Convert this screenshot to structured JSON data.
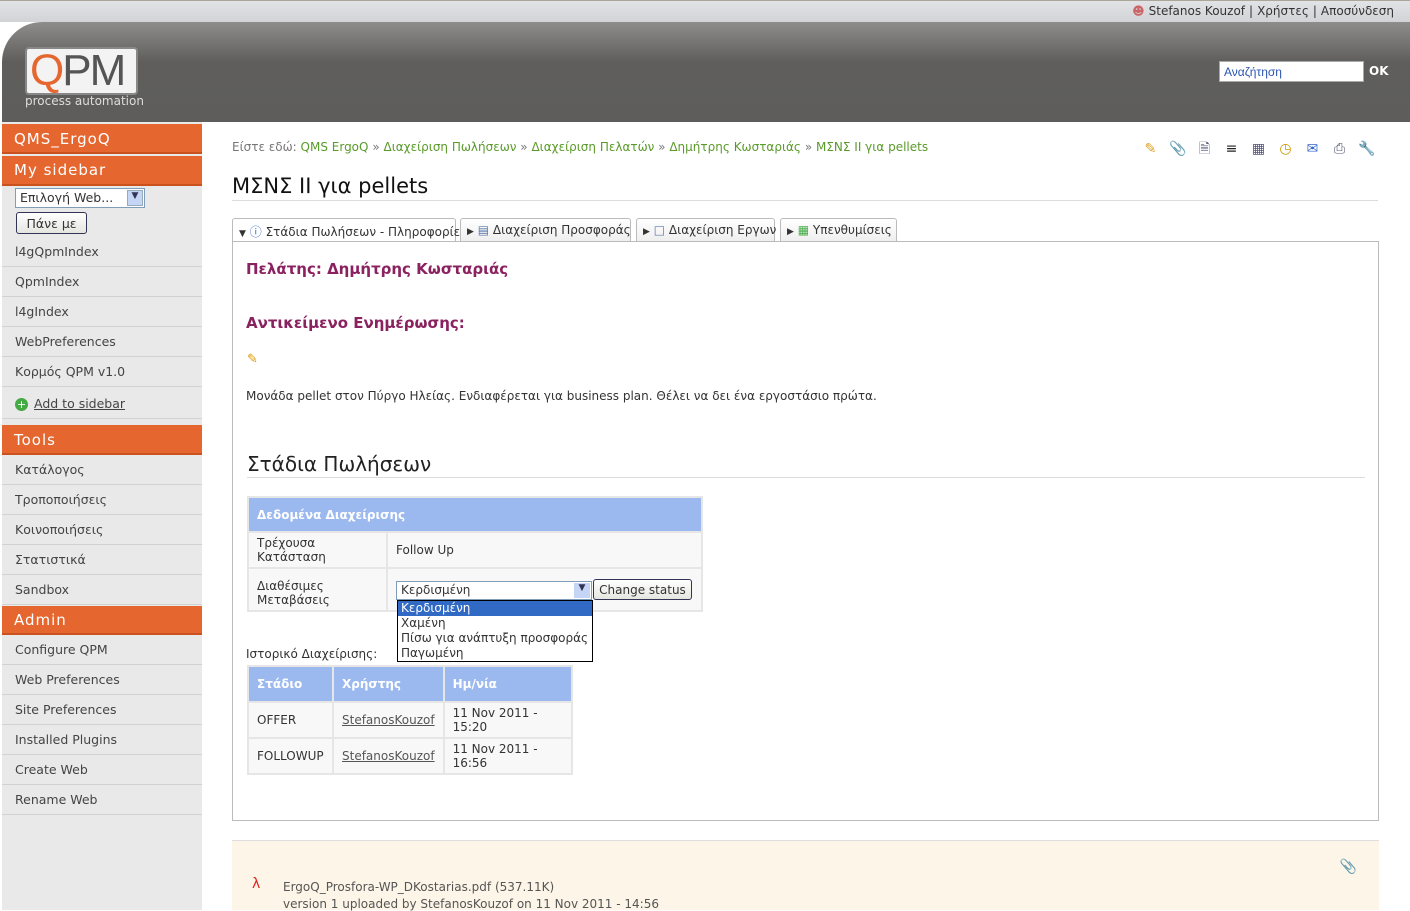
{
  "topbar": {
    "user": "Stefanos Kouzof",
    "users": "Χρήστες",
    "logout": "Αποσύνδεση",
    "sep": "|"
  },
  "logo": {
    "text": "QPM",
    "subtitle": "process automation"
  },
  "search": {
    "placeholder": "Αναζήτηση",
    "ok": "OK"
  },
  "sidebar": {
    "web_header": "QMS_ErgoQ",
    "my_sidebar": "My sidebar",
    "web_select": "Επιλογή Web...",
    "go": "Πάνε με",
    "my_items": [
      "l4gQpmIndex",
      "QpmIndex",
      "l4gIndex",
      "WebPreferences",
      "Κορμός QPM v1.0"
    ],
    "add": "Add to sidebar",
    "tools_header": "Tools",
    "tools": [
      "Κατάλογος",
      "Τροποποιήσεις",
      "Κοινοποιήσεις",
      "Στατιστικά",
      "Sandbox"
    ],
    "admin_header": "Admin",
    "admin": [
      "Configure QPM",
      "Web Preferences",
      "Site Preferences",
      "Installed Plugins",
      "Create Web",
      "Rename Web"
    ]
  },
  "breadcrumb": {
    "prefix": "Είστε εδώ:",
    "items": [
      "QMS ErgoQ",
      "Διαχείριση Πωλήσεων",
      "Διαχείριση Πελατών",
      "Δημήτρης Κωσταριάς",
      "ΜΣΝΣ ΙΙ για pellets"
    ],
    "sep": "»"
  },
  "toolbar_icons": [
    "edit-icon",
    "attach-icon",
    "new-page-icon",
    "text-icon",
    "archive-icon",
    "history-icon",
    "mail-icon",
    "print-icon",
    "settings-icon"
  ],
  "page": {
    "title": "ΜΣΝΣ ΙΙ για pellets"
  },
  "tabs": [
    "Στάδια Πωλήσεων - Πληροφορίες",
    "Διαχείριση Προσφοράς",
    "Διαχείριση Εργων",
    "Υπενθυμίσεις"
  ],
  "panel": {
    "client": "Πελάτης: Δημήτρης Κωσταριάς",
    "subject_label": "Αντικείμενο Ενημέρωσης:",
    "subject_text": "Μονάδα pellet στον Πύργο Ηλείας. Ενδιαφέρεται για business plan. Θέλει να δει ένα εργοστάσιο πρώτα.",
    "stages_title": "Στάδια Πωλήσεων",
    "mgmt": {
      "header": "Δεδομένα Διαχείρισης",
      "current_label": "Τρέχουσα Κατάσταση",
      "current_value": "Follow Up",
      "transitions_label": "Διαθέσιμες Μεταβάσεις",
      "selected": "Κερδισμένη",
      "options": [
        "Κερδισμένη",
        "Χαμένη",
        "Πίσω για ανάπτυξη προσφοράς",
        "Παγωμένη"
      ],
      "change": "Change status"
    },
    "history_label": "Ιστορικό Διαχείρισης:",
    "history": {
      "headers": [
        "Στάδιο",
        "Χρήστης",
        "Ημ/νία"
      ],
      "rows": [
        [
          "OFFER",
          "StefanosKouzof",
          "11 Nov 2011 - 15:20"
        ],
        [
          "FOLLOWUP",
          "StefanosKouzof",
          "11 Nov 2011 - 16:56"
        ]
      ]
    }
  },
  "attachment": {
    "file": "ErgoQ_Prosfora-WP_DKostarias.pdf",
    "size": "(537.11K)",
    "info": "version 1 uploaded by StefanosKouzof on 11 Nov 2011 - 14:56"
  },
  "colors": {
    "orange": "#e5662f",
    "header": "#5e5d5b",
    "link": "#5a9a2a",
    "table_header": "#9bb9ef",
    "heading": "#8b2260"
  }
}
